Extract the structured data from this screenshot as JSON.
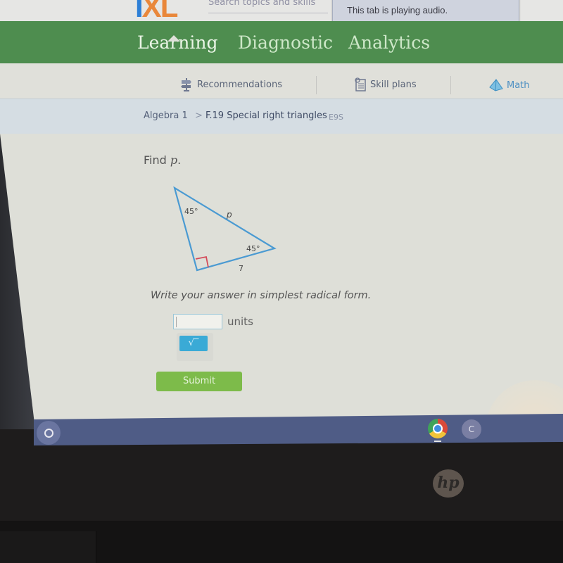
{
  "browser": {
    "logo_text_i": "I",
    "logo_text_x": "X",
    "logo_text_l": "L",
    "search_placeholder": "Search topics and skills",
    "tooltip": "This tab is playing audio."
  },
  "nav": {
    "items": [
      {
        "label": "Learning",
        "active": true
      },
      {
        "label": "Diagnostic",
        "active": false
      },
      {
        "label": "Analytics",
        "active": false
      }
    ]
  },
  "subnav": {
    "items": [
      {
        "label": "Recommendations",
        "icon": "signpost-icon"
      },
      {
        "label": "Skill plans",
        "icon": "clipboard-icon"
      },
      {
        "label": "Math",
        "icon": "pyramid-icon",
        "active": true
      }
    ]
  },
  "breadcrumb": {
    "course": "Algebra 1",
    "separator": ">",
    "skill": "F.19 Special right triangles",
    "code": "E9S"
  },
  "question": {
    "prompt_prefix": "Find ",
    "prompt_variable": "p",
    "prompt_suffix": ".",
    "triangle": {
      "angle_top": "45°",
      "angle_right": "45°",
      "hypotenuse_label": "p",
      "leg_label": "7",
      "right_angle": true
    },
    "instruction": "Write your answer in simplest radical form.",
    "answer_value": "",
    "units": "units",
    "sqrt_button": "√‾",
    "submit_label": "Submit"
  },
  "shelf": {
    "app_c_label": "C"
  },
  "hardware": {
    "brand": "hp"
  },
  "colors": {
    "nav_green": "#4e8d4f",
    "submit_green": "#7dbb4a",
    "sqrt_blue": "#3aaad6",
    "triangle_blue": "#4a9ad2",
    "right_angle_red": "#d44b5a",
    "active_tab_blue": "#3d7fc2"
  }
}
